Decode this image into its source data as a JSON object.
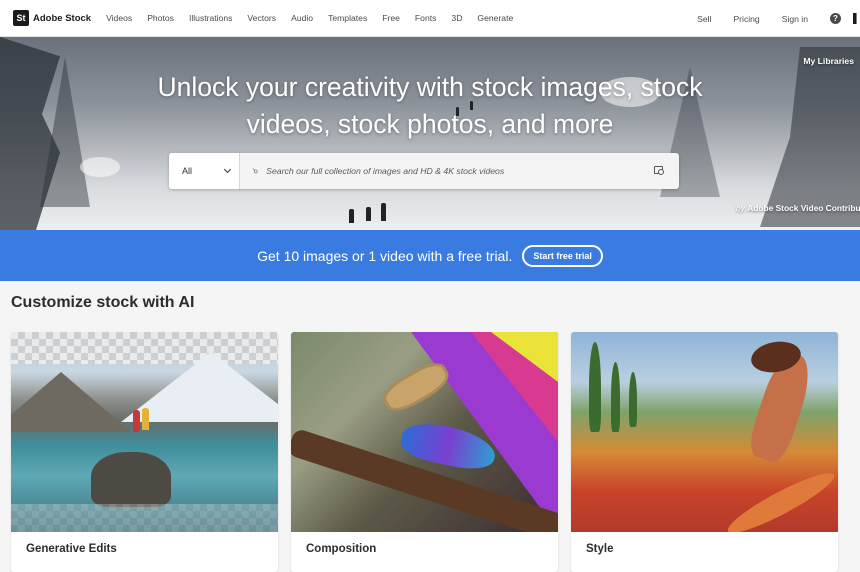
{
  "brand": {
    "badge": "St",
    "name": "Adobe Stock"
  },
  "nav": {
    "items": [
      "Videos",
      "Photos",
      "Illustrations",
      "Vectors",
      "Audio",
      "Templates",
      "Free",
      "Fonts",
      "3D",
      "Generate"
    ],
    "right": [
      "Sell",
      "Pricing",
      "Sign in"
    ],
    "help_icon": "?"
  },
  "hero": {
    "title": "Unlock your creativity with stock images, stock videos, stock photos, and more",
    "my_libraries": "My Libraries",
    "credit_by": "by",
    "credit_name": "Adobe Stock Video Contributor"
  },
  "search": {
    "category": "All",
    "placeholder": "Search our full collection of images and HD & 4K stock videos",
    "search_icon": "⌕"
  },
  "promo": {
    "text": "Get 10 images or 1 video with a free trial.",
    "button": "Start free trial",
    "color": "#3a7be1"
  },
  "section": {
    "title": "Customize stock with AI"
  },
  "cards": [
    {
      "label": "Generative Edits"
    },
    {
      "label": "Composition"
    },
    {
      "label": "Style"
    }
  ]
}
